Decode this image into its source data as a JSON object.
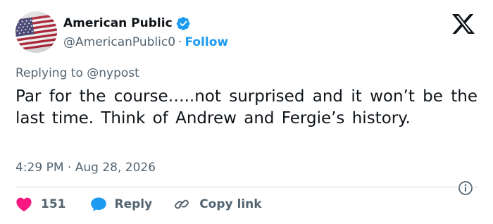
{
  "author": {
    "display_name": "American Public",
    "handle": "@AmericanPublic0",
    "separator": "·",
    "follow_label": "Follow",
    "verified_color": "#1d9bf0"
  },
  "reply_context": {
    "prefix": "Replying to",
    "mention": "@nypost"
  },
  "tweet": {
    "text": "Par for the course…..not surprised and it won’t be the last time. Think of Andrew and Fergie’s history.",
    "time": "4:29 PM",
    "separator": "·",
    "date": "Aug 28, 2026"
  },
  "actions": {
    "like_count": "151",
    "reply_label": "Reply",
    "copy_label": "Copy link"
  },
  "icons": {
    "avatar": "american-flag-avatar",
    "verified": "verified-badge-icon",
    "brand": "x-logo-icon",
    "info": "info-icon",
    "like": "heart-icon",
    "reply": "speech-bubble-icon",
    "copy": "link-icon"
  },
  "colors": {
    "accent": "#1d9bf0",
    "like": "#f91880",
    "text_primary": "#0f1419",
    "text_secondary": "#536471",
    "divider": "#cfd9de"
  }
}
